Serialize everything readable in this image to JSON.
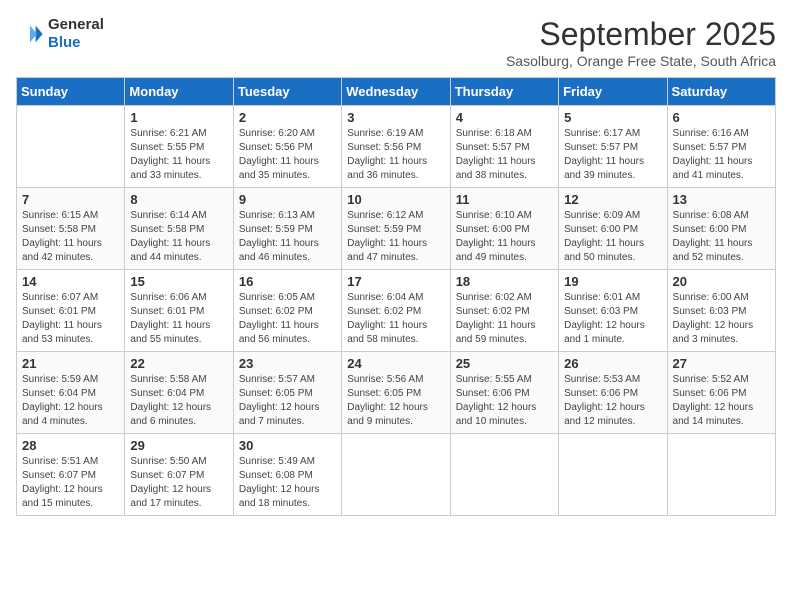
{
  "header": {
    "logo_general": "General",
    "logo_blue": "Blue",
    "month": "September 2025",
    "location": "Sasolburg, Orange Free State, South Africa"
  },
  "weekdays": [
    "Sunday",
    "Monday",
    "Tuesday",
    "Wednesday",
    "Thursday",
    "Friday",
    "Saturday"
  ],
  "weeks": [
    [
      {
        "day": "",
        "info": ""
      },
      {
        "day": "1",
        "info": "Sunrise: 6:21 AM\nSunset: 5:55 PM\nDaylight: 11 hours\nand 33 minutes."
      },
      {
        "day": "2",
        "info": "Sunrise: 6:20 AM\nSunset: 5:56 PM\nDaylight: 11 hours\nand 35 minutes."
      },
      {
        "day": "3",
        "info": "Sunrise: 6:19 AM\nSunset: 5:56 PM\nDaylight: 11 hours\nand 36 minutes."
      },
      {
        "day": "4",
        "info": "Sunrise: 6:18 AM\nSunset: 5:57 PM\nDaylight: 11 hours\nand 38 minutes."
      },
      {
        "day": "5",
        "info": "Sunrise: 6:17 AM\nSunset: 5:57 PM\nDaylight: 11 hours\nand 39 minutes."
      },
      {
        "day": "6",
        "info": "Sunrise: 6:16 AM\nSunset: 5:57 PM\nDaylight: 11 hours\nand 41 minutes."
      }
    ],
    [
      {
        "day": "7",
        "info": "Sunrise: 6:15 AM\nSunset: 5:58 PM\nDaylight: 11 hours\nand 42 minutes."
      },
      {
        "day": "8",
        "info": "Sunrise: 6:14 AM\nSunset: 5:58 PM\nDaylight: 11 hours\nand 44 minutes."
      },
      {
        "day": "9",
        "info": "Sunrise: 6:13 AM\nSunset: 5:59 PM\nDaylight: 11 hours\nand 46 minutes."
      },
      {
        "day": "10",
        "info": "Sunrise: 6:12 AM\nSunset: 5:59 PM\nDaylight: 11 hours\nand 47 minutes."
      },
      {
        "day": "11",
        "info": "Sunrise: 6:10 AM\nSunset: 6:00 PM\nDaylight: 11 hours\nand 49 minutes."
      },
      {
        "day": "12",
        "info": "Sunrise: 6:09 AM\nSunset: 6:00 PM\nDaylight: 11 hours\nand 50 minutes."
      },
      {
        "day": "13",
        "info": "Sunrise: 6:08 AM\nSunset: 6:00 PM\nDaylight: 11 hours\nand 52 minutes."
      }
    ],
    [
      {
        "day": "14",
        "info": "Sunrise: 6:07 AM\nSunset: 6:01 PM\nDaylight: 11 hours\nand 53 minutes."
      },
      {
        "day": "15",
        "info": "Sunrise: 6:06 AM\nSunset: 6:01 PM\nDaylight: 11 hours\nand 55 minutes."
      },
      {
        "day": "16",
        "info": "Sunrise: 6:05 AM\nSunset: 6:02 PM\nDaylight: 11 hours\nand 56 minutes."
      },
      {
        "day": "17",
        "info": "Sunrise: 6:04 AM\nSunset: 6:02 PM\nDaylight: 11 hours\nand 58 minutes."
      },
      {
        "day": "18",
        "info": "Sunrise: 6:02 AM\nSunset: 6:02 PM\nDaylight: 11 hours\nand 59 minutes."
      },
      {
        "day": "19",
        "info": "Sunrise: 6:01 AM\nSunset: 6:03 PM\nDaylight: 12 hours\nand 1 minute."
      },
      {
        "day": "20",
        "info": "Sunrise: 6:00 AM\nSunset: 6:03 PM\nDaylight: 12 hours\nand 3 minutes."
      }
    ],
    [
      {
        "day": "21",
        "info": "Sunrise: 5:59 AM\nSunset: 6:04 PM\nDaylight: 12 hours\nand 4 minutes."
      },
      {
        "day": "22",
        "info": "Sunrise: 5:58 AM\nSunset: 6:04 PM\nDaylight: 12 hours\nand 6 minutes."
      },
      {
        "day": "23",
        "info": "Sunrise: 5:57 AM\nSunset: 6:05 PM\nDaylight: 12 hours\nand 7 minutes."
      },
      {
        "day": "24",
        "info": "Sunrise: 5:56 AM\nSunset: 6:05 PM\nDaylight: 12 hours\nand 9 minutes."
      },
      {
        "day": "25",
        "info": "Sunrise: 5:55 AM\nSunset: 6:06 PM\nDaylight: 12 hours\nand 10 minutes."
      },
      {
        "day": "26",
        "info": "Sunrise: 5:53 AM\nSunset: 6:06 PM\nDaylight: 12 hours\nand 12 minutes."
      },
      {
        "day": "27",
        "info": "Sunrise: 5:52 AM\nSunset: 6:06 PM\nDaylight: 12 hours\nand 14 minutes."
      }
    ],
    [
      {
        "day": "28",
        "info": "Sunrise: 5:51 AM\nSunset: 6:07 PM\nDaylight: 12 hours\nand 15 minutes."
      },
      {
        "day": "29",
        "info": "Sunrise: 5:50 AM\nSunset: 6:07 PM\nDaylight: 12 hours\nand 17 minutes."
      },
      {
        "day": "30",
        "info": "Sunrise: 5:49 AM\nSunset: 6:08 PM\nDaylight: 12 hours\nand 18 minutes."
      },
      {
        "day": "",
        "info": ""
      },
      {
        "day": "",
        "info": ""
      },
      {
        "day": "",
        "info": ""
      },
      {
        "day": "",
        "info": ""
      }
    ]
  ]
}
